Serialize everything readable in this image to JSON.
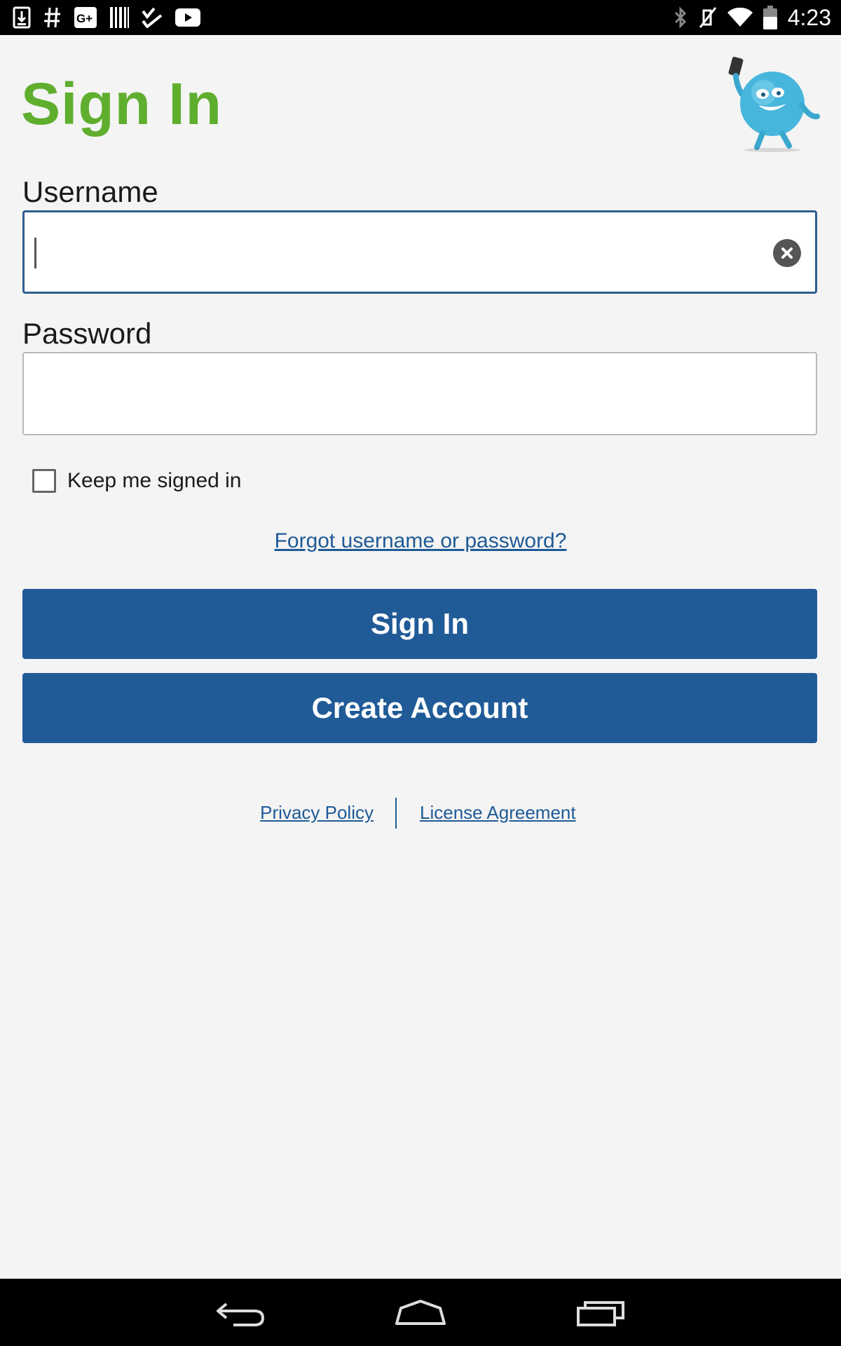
{
  "status_bar": {
    "time": "4:23",
    "left_icons": [
      "download-icon",
      "hash-icon",
      "google-plus-icon",
      "barcode-icon",
      "checklist-icon",
      "youtube-icon"
    ],
    "right_icons": [
      "bluetooth-icon",
      "vibrate-off-icon",
      "wifi-icon",
      "battery-icon"
    ]
  },
  "page": {
    "title": "Sign In",
    "mascot_icon": "mascot-icon"
  },
  "form": {
    "username_label": "Username",
    "username_value": "",
    "password_label": "Password",
    "password_value": "",
    "keep_signed_in_label": "Keep me signed in",
    "keep_signed_in_checked": false,
    "forgot_link": "Forgot username or password?",
    "sign_in_button": "Sign In",
    "create_account_button": "Create Account"
  },
  "footer": {
    "privacy_policy": "Privacy Policy",
    "license_agreement": "License Agreement"
  },
  "nav_bar": {
    "icons": [
      "back-icon",
      "home-icon",
      "recent-apps-icon"
    ]
  },
  "colors": {
    "title_green": "#5fae2e",
    "button_blue": "#205b97",
    "link_blue": "#1e5a96",
    "focus_border": "#2d5d93",
    "background": "#f4f4f4"
  }
}
